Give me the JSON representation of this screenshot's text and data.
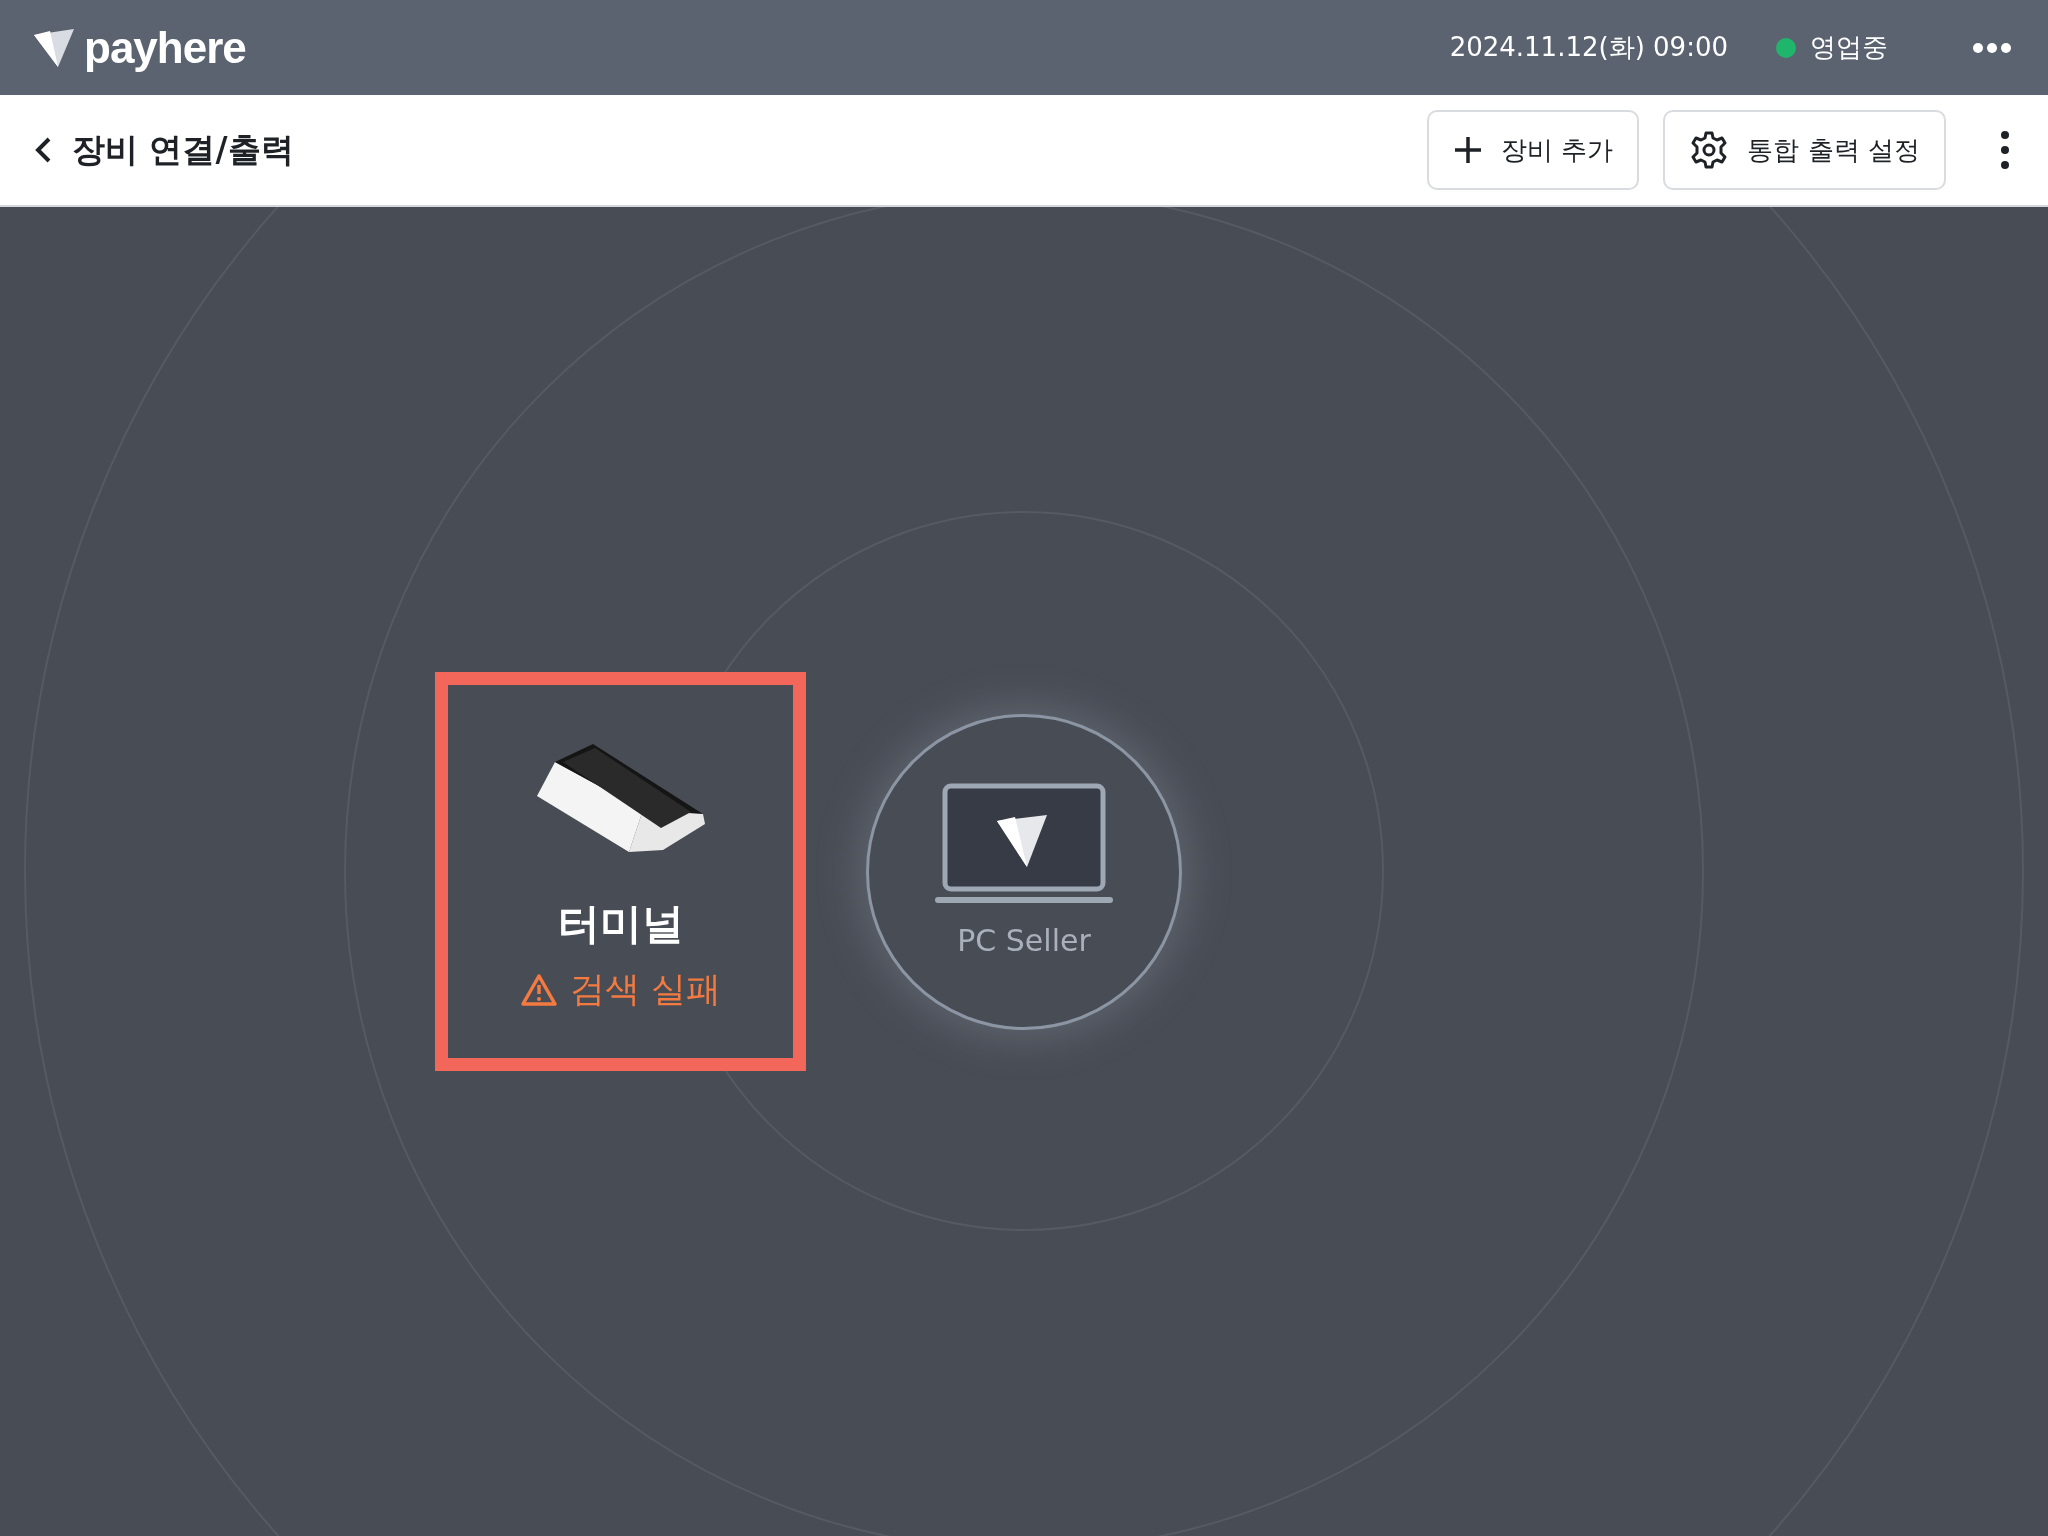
{
  "top_bar": {
    "logo": "payhere",
    "datetime": "2024.11.12(화) 09:00",
    "store_status": {
      "label": "영업중",
      "color": "#1fb56b"
    }
  },
  "header": {
    "title": "장비 연결/출력",
    "buttons": [
      {
        "kind": "add",
        "label": "장비 추가"
      },
      {
        "kind": "settings",
        "label": "통합 출력 설정"
      }
    ]
  },
  "devices": [
    {
      "kind": "terminal",
      "name": "터미널",
      "error": true,
      "status": "검색 실패"
    },
    {
      "kind": "pc",
      "name": "PC Seller",
      "error": false
    }
  ]
}
